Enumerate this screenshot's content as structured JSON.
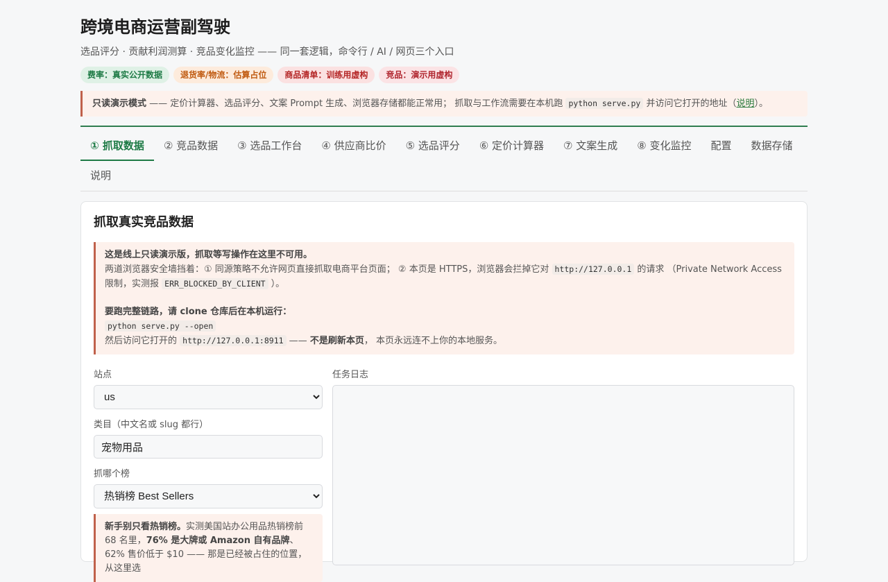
{
  "header": {
    "title": "跨境电商运营副驾驶",
    "subtitle": "选品评分 · 贡献利润测算 · 竞品变化监控 —— 同一套逻辑，命令行 / AI / 网页三个入口",
    "badges": [
      {
        "label": "费率：真实公开数据",
        "color": "#1d7a45"
      },
      {
        "label": "退货率/物流：估算占位",
        "color": "#c05a10"
      },
      {
        "label": "商品清单：训练用虚构",
        "color": "#b42525"
      },
      {
        "label": "竞品：演示用虚构",
        "color": "#b0262f"
      }
    ]
  },
  "notice": {
    "strong": "只读演示模式",
    "text1": " —— 定价计算器、选品评分、文案 Prompt 生成、浏览器存储都能正常用； 抓取与工作流需要在本机跑 ",
    "code": "python serve.py",
    "text2": " 并访问它打开的地址（",
    "link": "说明",
    "text3": "）。"
  },
  "tabs": [
    {
      "label": "① 抓取数据",
      "active": true
    },
    {
      "label": "② 竞品数据"
    },
    {
      "label": "③ 选品工作台"
    },
    {
      "label": "④ 供应商比价"
    },
    {
      "label": "⑤ 选品评分"
    },
    {
      "label": "⑥ 定价计算器"
    },
    {
      "label": "⑦ 文案生成"
    },
    {
      "label": "⑧ 变化监控"
    },
    {
      "label": "配置"
    },
    {
      "label": "数据存储"
    },
    {
      "label": "说明"
    }
  ],
  "card": {
    "title": "抓取真实竞品数据",
    "warning": {
      "heading": "这是线上只读演示版，抓取等写操作在这里不可用。",
      "line1_a": "两道浏览器安全墙挡着：① 同源策略不允许网页直接抓取电商平台页面； ② 本页是 HTTPS，浏览器会拦掉它对 ",
      "code1": "http://127.0.0.1",
      "line1_b": " 的请求 （Private Network Access 限制，实测报 ",
      "code2": "ERR_BLOCKED_BY_CLIENT",
      "line1_c": " ）。",
      "heading2": "要跑完整链路，请 clone 仓库后在本机运行：",
      "code3": "python serve.py --open",
      "line3_a": "然后访问它打开的 ",
      "code4": "http://127.0.0.1:8911",
      "line3_b": " —— ",
      "strong3": "不是刷新本页",
      "line3_c": "， 本页永远连不上你的本地服务。"
    },
    "form": {
      "site_label": "站点",
      "site_value": "us",
      "category_label": "类目（中文名或 slug 都行）",
      "category_value": "宠物用品",
      "list_label": "抓哪个榜",
      "list_value": "热销榜 Best Sellers"
    },
    "log_label": "任务日志",
    "tip": {
      "strong1": "新手别只看热销榜。",
      "text1": "实测美国站办公用品热销榜前 68 名里，",
      "strong2": "76% 是大牌或 Amazon 自有品牌",
      "text2": "、62% 售价低于 $10 —— 那是已经被占住的位置，从这里选"
    }
  }
}
